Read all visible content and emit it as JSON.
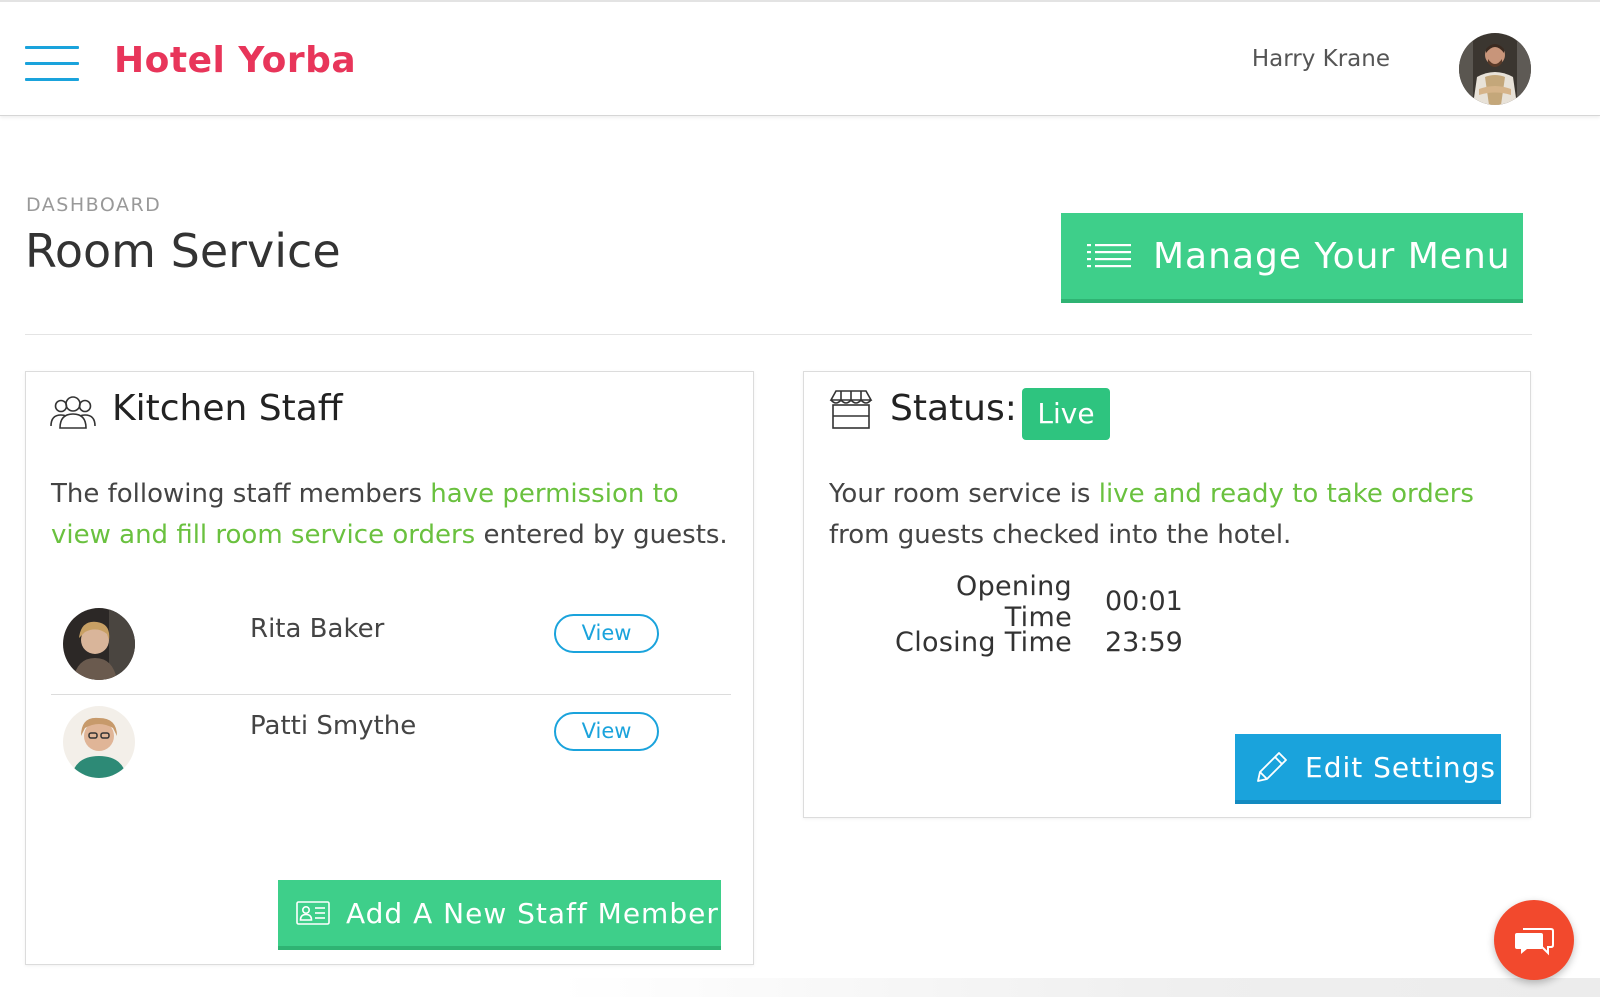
{
  "app": {
    "logo": "Hotel Yorba",
    "user_name": "Harry Krane"
  },
  "header": {
    "breadcrumb": "DASHBOARD",
    "title": "Room Service",
    "manage_menu_label": "Manage Your Menu"
  },
  "kitchen_staff": {
    "title": "Kitchen Staff",
    "intro_before": "The following staff members ",
    "intro_highlight": "have permission to view and fill room service orders",
    "intro_after": " entered by guests.",
    "members": [
      {
        "name": "Rita Baker",
        "action": "View"
      },
      {
        "name": "Patti Smythe",
        "action": "View"
      }
    ],
    "add_label": "Add A New Staff Member"
  },
  "status": {
    "title": "Status:",
    "badge": "Live",
    "text_before": "Your room service is ",
    "text_highlight": "live and ready to take orders",
    "text_after": " from guests checked into the hotel.",
    "opening_label": "Opening Time",
    "opening_value": "00:01",
    "closing_label": "Closing Time",
    "closing_value": "23:59",
    "edit_label": "Edit Settings"
  },
  "colors": {
    "brand": "#e8355a",
    "primary_green": "#3ecf8a",
    "primary_blue": "#1aa3dc",
    "highlight": "#6ac13f",
    "chat": "#f2492d"
  },
  "icons": {
    "menu": "hamburger-icon",
    "list": "list-icon",
    "staff": "users-icon",
    "status": "storefront-icon",
    "id_card": "id-card-icon",
    "pencil": "pencil-icon",
    "chat": "chat-icon"
  }
}
